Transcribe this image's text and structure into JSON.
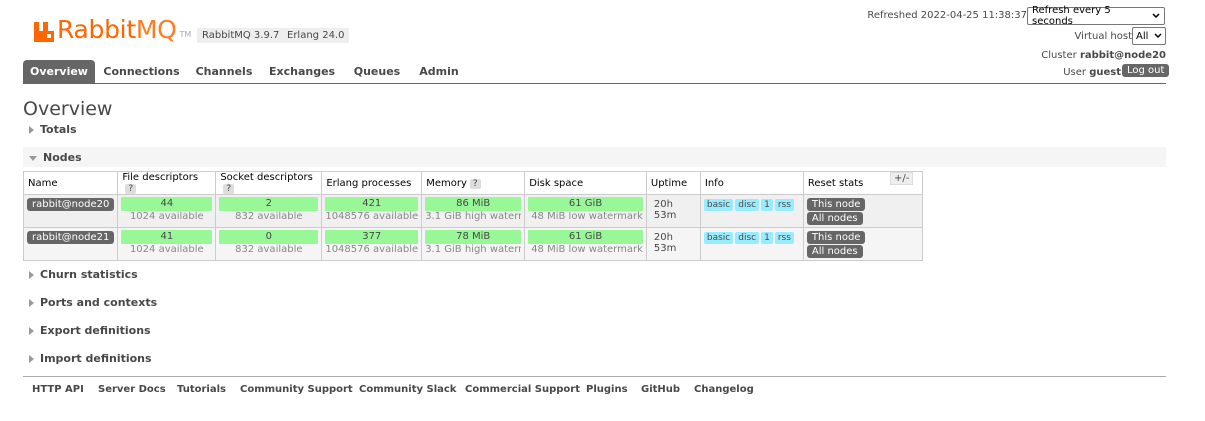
{
  "header": {
    "logo_text_rabbit": "Rabbit",
    "logo_text_mq": "MQ",
    "logo_tm": "TM",
    "version": "RabbitMQ 3.9.7",
    "erlang": "Erlang 24.0",
    "refreshed": "Refreshed 2022-04-25 11:38:37",
    "refresh_option": "Refresh every 5 seconds",
    "vhost_label": "Virtual host",
    "vhost_value": "All",
    "cluster_label": "Cluster",
    "cluster_value": "rabbit@node20",
    "user_label": "User",
    "user_value": "guest",
    "logout": "Log out"
  },
  "tabs": [
    {
      "label": "Overview"
    },
    {
      "label": "Connections"
    },
    {
      "label": "Channels"
    },
    {
      "label": "Exchanges"
    },
    {
      "label": "Queues"
    },
    {
      "label": "Admin"
    }
  ],
  "page_title": "Overview",
  "sections": {
    "totals": "Totals",
    "nodes": "Nodes",
    "churn": "Churn statistics",
    "ports": "Ports and contexts",
    "export": "Export definitions",
    "import": "Import definitions"
  },
  "table": {
    "headers": [
      "Name",
      "File descriptors",
      "Socket descriptors",
      "Erlang processes",
      "Memory",
      "Disk space",
      "Uptime",
      "Info",
      "Reset stats"
    ],
    "help": "?",
    "plusminus": "+/-",
    "rows": [
      {
        "name": "rabbit@node20",
        "fd": "44",
        "fd_avail": "1024 available",
        "sd": "2",
        "sd_avail": "832 available",
        "ep": "421",
        "ep_avail": "1048576 available",
        "mem": "86 MiB",
        "mem_wm": "3.1 GiB high watermark",
        "disk": "61 GiB",
        "disk_wm": "48 MiB low watermark",
        "uptime": "20h 53m",
        "info": [
          "basic",
          "disc",
          "1",
          "rss"
        ],
        "this_node": "This node",
        "all_nodes": "All nodes"
      },
      {
        "name": "rabbit@node21",
        "fd": "41",
        "fd_avail": "1024 available",
        "sd": "0",
        "sd_avail": "832 available",
        "ep": "377",
        "ep_avail": "1048576 available",
        "mem": "78 MiB",
        "mem_wm": "3.1 GiB high watermark",
        "disk": "61 GiB",
        "disk_wm": "48 MiB low watermark",
        "uptime": "20h 53m",
        "info": [
          "basic",
          "disc",
          "1",
          "rss"
        ],
        "this_node": "This node",
        "all_nodes": "All nodes"
      }
    ]
  },
  "footer": [
    "HTTP API",
    "Server Docs",
    "Tutorials",
    "Community Support",
    "Community Slack",
    "Commercial Support",
    "Plugins",
    "GitHub",
    "Changelog"
  ],
  "colors": {
    "brand": "#ff6600",
    "bar": "#98f898",
    "badge": "#99ebff",
    "button": "#666666"
  }
}
